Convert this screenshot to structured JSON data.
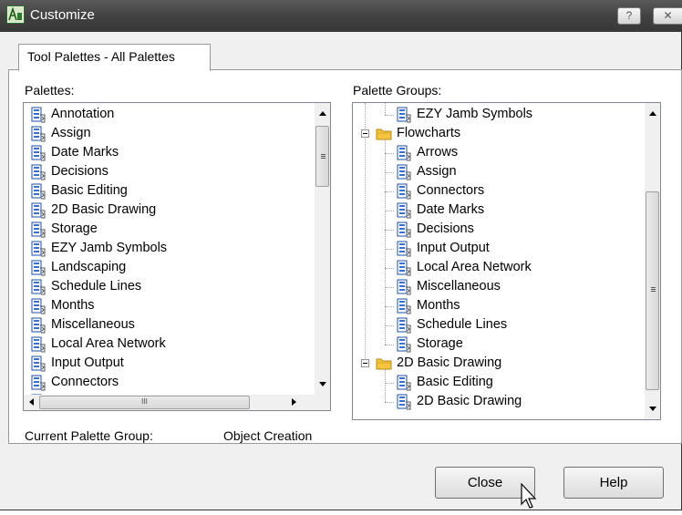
{
  "window": {
    "title": "Customize",
    "help_glyph": "?",
    "close_glyph": "✕"
  },
  "tabs": [
    {
      "label": "Tool Palettes - All Palettes",
      "selected": true
    }
  ],
  "palettes": {
    "label": "Palettes:",
    "items": [
      "Annotation",
      "Assign",
      "Date Marks",
      "Decisions",
      "Basic Editing",
      "2D Basic Drawing",
      "Storage",
      "EZY Jamb Symbols",
      "Landscaping",
      "Schedule Lines",
      "Months",
      "Miscellaneous",
      "Local Area Network",
      "Input Output",
      "Connectors"
    ],
    "hscroll_grip": "III"
  },
  "palette_groups": {
    "label": "Palette Groups:",
    "top_item": "EZY Jamb Symbols",
    "groups": [
      {
        "name": "Flowcharts",
        "children": [
          "Arrows",
          "Assign",
          "Connectors",
          "Date Marks",
          "Decisions",
          "Input Output",
          "Local Area Network",
          "Miscellaneous",
          "Months",
          "Schedule Lines",
          "Storage"
        ]
      },
      {
        "name": "2D Basic Drawing",
        "children": [
          "Basic Editing",
          "2D Basic Drawing"
        ]
      }
    ]
  },
  "current_group": {
    "label": "Current Palette Group:",
    "value": "Object Creation"
  },
  "buttons": {
    "close": "Close",
    "help": "Help"
  },
  "colors": {
    "titlebar": "#404040",
    "folder": "#f5c542",
    "palette_icon": "#1e4fa0"
  }
}
